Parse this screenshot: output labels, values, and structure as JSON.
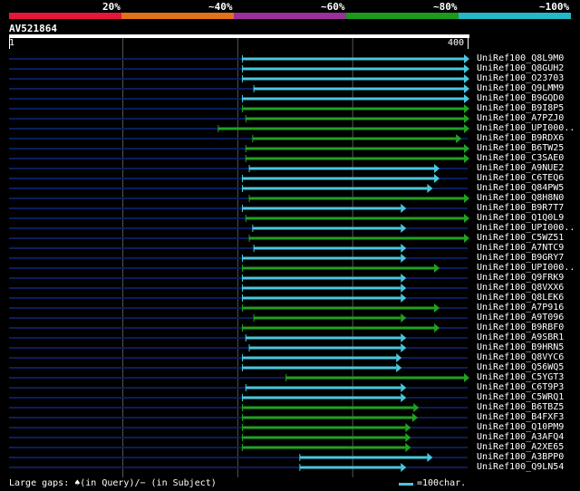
{
  "scale": {
    "segments": [
      {
        "label": "",
        "color": "#e5163a"
      },
      {
        "label": "20%",
        "color": "#e3701a"
      },
      {
        "label": "~40%",
        "color": "#9b2f9b"
      },
      {
        "label": "~60%",
        "color": "#1c9a1c"
      },
      {
        "label": "~80%",
        "color": "#24b8c8"
      }
    ],
    "last_label": "~100%"
  },
  "query": {
    "name": "AV521864",
    "start": "1",
    "end": "400",
    "length": 400
  },
  "colors": {
    "cyan": "#49c7dc",
    "green": "#22a122",
    "background_line": "#0b1e5c",
    "gridline": "#555555"
  },
  "footer": {
    "left_text": "Large gaps: ♠(in Query)/− (in Subject)",
    "right_text": "=100char."
  },
  "hits": [
    {
      "name": "UniRef100_Q8L9M0",
      "start": 204,
      "end": 400,
      "color": "cyan"
    },
    {
      "name": "UniRef100_Q8GUH2",
      "start": 204,
      "end": 400,
      "color": "cyan"
    },
    {
      "name": "UniRef100_O23703",
      "start": 204,
      "end": 400,
      "color": "cyan"
    },
    {
      "name": "UniRef100_Q9LMM9",
      "start": 214,
      "end": 400,
      "color": "cyan"
    },
    {
      "name": "UniRef100_B9GQD0",
      "start": 204,
      "end": 400,
      "color": "cyan"
    },
    {
      "name": "UniRef100_B9I8P5",
      "start": 204,
      "end": 400,
      "color": "green"
    },
    {
      "name": "UniRef100_A7PZJ0",
      "start": 207,
      "end": 400,
      "color": "green"
    },
    {
      "name": "UniRef100_UPI000..",
      "start": 183,
      "end": 400,
      "color": "green"
    },
    {
      "name": "UniRef100_B9RDX6",
      "start": 213,
      "end": 393,
      "color": "green"
    },
    {
      "name": "UniRef100_B6TW25",
      "start": 207,
      "end": 400,
      "color": "green"
    },
    {
      "name": "UniRef100_C3SAE0",
      "start": 207,
      "end": 400,
      "color": "green"
    },
    {
      "name": "UniRef100_A9NUE2",
      "start": 210,
      "end": 374,
      "color": "cyan"
    },
    {
      "name": "UniRef100_C6TEQ6",
      "start": 204,
      "end": 374,
      "color": "cyan"
    },
    {
      "name": "UniRef100_Q84PW5",
      "start": 204,
      "end": 368,
      "color": "cyan"
    },
    {
      "name": "UniRef100_Q8H8N0",
      "start": 210,
      "end": 400,
      "color": "green"
    },
    {
      "name": "UniRef100_B9R7T7",
      "start": 204,
      "end": 345,
      "color": "cyan"
    },
    {
      "name": "UniRef100_Q1Q0L9",
      "start": 207,
      "end": 400,
      "color": "green"
    },
    {
      "name": "UniRef100_UPI000..",
      "start": 213,
      "end": 345,
      "color": "cyan"
    },
    {
      "name": "UniRef100_C5WZ51",
      "start": 210,
      "end": 400,
      "color": "green"
    },
    {
      "name": "UniRef100_A7NTC9",
      "start": 214,
      "end": 345,
      "color": "cyan"
    },
    {
      "name": "UniRef100_B9GRY7",
      "start": 204,
      "end": 345,
      "color": "cyan"
    },
    {
      "name": "UniRef100_UPI000..",
      "start": 204,
      "end": 374,
      "color": "green"
    },
    {
      "name": "UniRef100_Q9FRK9",
      "start": 204,
      "end": 345,
      "color": "cyan"
    },
    {
      "name": "UniRef100_Q8VXX6",
      "start": 204,
      "end": 345,
      "color": "cyan"
    },
    {
      "name": "UniRef100_Q8LEK6",
      "start": 204,
      "end": 345,
      "color": "cyan"
    },
    {
      "name": "UniRef100_A7P916",
      "start": 204,
      "end": 374,
      "color": "green"
    },
    {
      "name": "UniRef100_A9T096",
      "start": 214,
      "end": 345,
      "color": "green"
    },
    {
      "name": "UniRef100_B9RBF0",
      "start": 204,
      "end": 374,
      "color": "green"
    },
    {
      "name": "UniRef100_A9SBR1",
      "start": 207,
      "end": 345,
      "color": "cyan"
    },
    {
      "name": "UniRef100_B9HRN5",
      "start": 210,
      "end": 345,
      "color": "cyan"
    },
    {
      "name": "UniRef100_Q8VYC6",
      "start": 204,
      "end": 341,
      "color": "cyan"
    },
    {
      "name": "UniRef100_Q56WQ5",
      "start": 204,
      "end": 341,
      "color": "cyan"
    },
    {
      "name": "UniRef100_C5YGT3",
      "start": 242,
      "end": 400,
      "color": "green"
    },
    {
      "name": "UniRef100_C6T9P3",
      "start": 207,
      "end": 345,
      "color": "cyan"
    },
    {
      "name": "UniRef100_C5WRQ1",
      "start": 204,
      "end": 345,
      "color": "cyan"
    },
    {
      "name": "UniRef100_B6TBZ5",
      "start": 204,
      "end": 356,
      "color": "green"
    },
    {
      "name": "UniRef100_B4FXF3",
      "start": 204,
      "end": 355,
      "color": "green"
    },
    {
      "name": "UniRef100_Q10PM9",
      "start": 204,
      "end": 349,
      "color": "green"
    },
    {
      "name": "UniRef100_A3AFQ4",
      "start": 204,
      "end": 349,
      "color": "green"
    },
    {
      "name": "UniRef100_A2XE65",
      "start": 204,
      "end": 349,
      "color": "green"
    },
    {
      "name": "UniRef100_A3BPP0",
      "start": 254,
      "end": 368,
      "color": "cyan"
    },
    {
      "name": "UniRef100_Q9LN54",
      "start": 254,
      "end": 345,
      "color": "cyan"
    }
  ]
}
